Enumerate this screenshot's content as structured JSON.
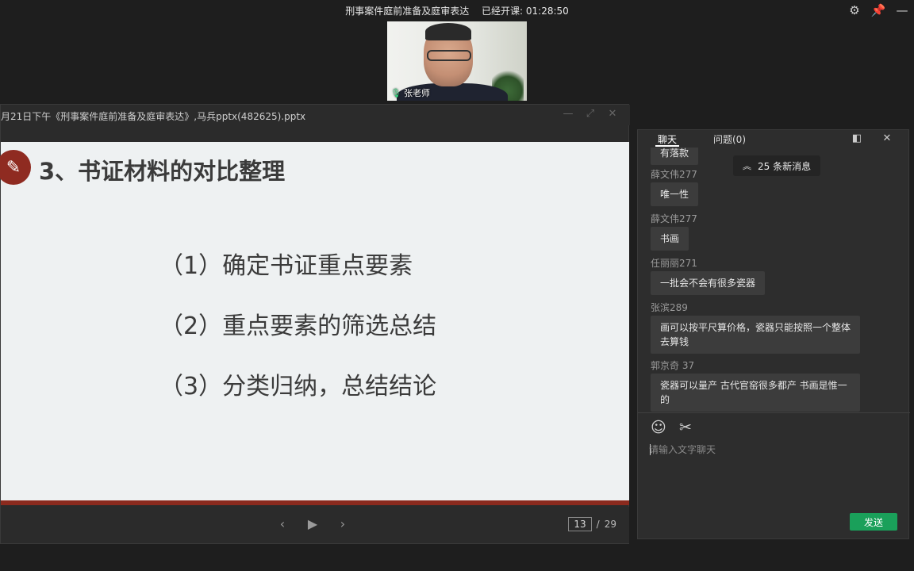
{
  "window": {
    "course_title": "刑事案件庭前准备及庭审表达",
    "elapsed": "已经开课: 01:28:50",
    "icons": [
      "gear-icon",
      "pin-icon",
      "minimize-icon"
    ]
  },
  "video": {
    "speaker": "张老师",
    "mic_icon": "microphone-icon"
  },
  "document": {
    "title": "月21日下午《刑事案件庭前准备及庭审表达》,马兵pptx(482625).pptx",
    "slide": {
      "heading": "3、书证材料的对比整理",
      "items": [
        "（1）确定书证重点要素",
        "（2）重点要素的筛选总结",
        "（3）分类归纳，总结结论"
      ]
    },
    "pager": {
      "current": "13",
      "separator": "/",
      "total": "29"
    }
  },
  "chat": {
    "tabs": [
      "聊天",
      "问题(0)"
    ],
    "new_messages": "25 条新消息",
    "messages": [
      {
        "name": "",
        "text": "有落款"
      },
      {
        "name": "薛文伟277",
        "text": "唯一性"
      },
      {
        "name": "薛文伟277",
        "text": "书画"
      },
      {
        "name": "任丽丽271",
        "text": "一批会不会有很多瓷器"
      },
      {
        "name": "张滨289",
        "text": "画可以按平尺算价格，瓷器只能按照一个整体去算钱"
      },
      {
        "name": "郭京奇 37",
        "text": "瓷器可以量产 古代官窑很多都产 书画是惟一的"
      }
    ],
    "input_placeholder": "请输入文字聊天",
    "send_label": "发送",
    "accent": "#1aa05a"
  }
}
